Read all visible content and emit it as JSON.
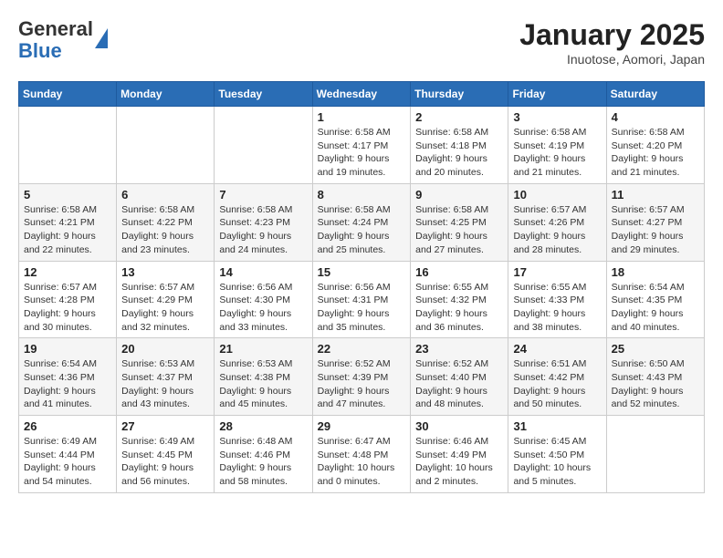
{
  "header": {
    "logo_general": "General",
    "logo_blue": "Blue",
    "month_title": "January 2025",
    "location": "Inuotose, Aomori, Japan"
  },
  "weekdays": [
    "Sunday",
    "Monday",
    "Tuesday",
    "Wednesday",
    "Thursday",
    "Friday",
    "Saturday"
  ],
  "weeks": [
    [
      {
        "day": "",
        "info": ""
      },
      {
        "day": "",
        "info": ""
      },
      {
        "day": "",
        "info": ""
      },
      {
        "day": "1",
        "info": "Sunrise: 6:58 AM\nSunset: 4:17 PM\nDaylight: 9 hours\nand 19 minutes."
      },
      {
        "day": "2",
        "info": "Sunrise: 6:58 AM\nSunset: 4:18 PM\nDaylight: 9 hours\nand 20 minutes."
      },
      {
        "day": "3",
        "info": "Sunrise: 6:58 AM\nSunset: 4:19 PM\nDaylight: 9 hours\nand 21 minutes."
      },
      {
        "day": "4",
        "info": "Sunrise: 6:58 AM\nSunset: 4:20 PM\nDaylight: 9 hours\nand 21 minutes."
      }
    ],
    [
      {
        "day": "5",
        "info": "Sunrise: 6:58 AM\nSunset: 4:21 PM\nDaylight: 9 hours\nand 22 minutes."
      },
      {
        "day": "6",
        "info": "Sunrise: 6:58 AM\nSunset: 4:22 PM\nDaylight: 9 hours\nand 23 minutes."
      },
      {
        "day": "7",
        "info": "Sunrise: 6:58 AM\nSunset: 4:23 PM\nDaylight: 9 hours\nand 24 minutes."
      },
      {
        "day": "8",
        "info": "Sunrise: 6:58 AM\nSunset: 4:24 PM\nDaylight: 9 hours\nand 25 minutes."
      },
      {
        "day": "9",
        "info": "Sunrise: 6:58 AM\nSunset: 4:25 PM\nDaylight: 9 hours\nand 27 minutes."
      },
      {
        "day": "10",
        "info": "Sunrise: 6:57 AM\nSunset: 4:26 PM\nDaylight: 9 hours\nand 28 minutes."
      },
      {
        "day": "11",
        "info": "Sunrise: 6:57 AM\nSunset: 4:27 PM\nDaylight: 9 hours\nand 29 minutes."
      }
    ],
    [
      {
        "day": "12",
        "info": "Sunrise: 6:57 AM\nSunset: 4:28 PM\nDaylight: 9 hours\nand 30 minutes."
      },
      {
        "day": "13",
        "info": "Sunrise: 6:57 AM\nSunset: 4:29 PM\nDaylight: 9 hours\nand 32 minutes."
      },
      {
        "day": "14",
        "info": "Sunrise: 6:56 AM\nSunset: 4:30 PM\nDaylight: 9 hours\nand 33 minutes."
      },
      {
        "day": "15",
        "info": "Sunrise: 6:56 AM\nSunset: 4:31 PM\nDaylight: 9 hours\nand 35 minutes."
      },
      {
        "day": "16",
        "info": "Sunrise: 6:55 AM\nSunset: 4:32 PM\nDaylight: 9 hours\nand 36 minutes."
      },
      {
        "day": "17",
        "info": "Sunrise: 6:55 AM\nSunset: 4:33 PM\nDaylight: 9 hours\nand 38 minutes."
      },
      {
        "day": "18",
        "info": "Sunrise: 6:54 AM\nSunset: 4:35 PM\nDaylight: 9 hours\nand 40 minutes."
      }
    ],
    [
      {
        "day": "19",
        "info": "Sunrise: 6:54 AM\nSunset: 4:36 PM\nDaylight: 9 hours\nand 41 minutes."
      },
      {
        "day": "20",
        "info": "Sunrise: 6:53 AM\nSunset: 4:37 PM\nDaylight: 9 hours\nand 43 minutes."
      },
      {
        "day": "21",
        "info": "Sunrise: 6:53 AM\nSunset: 4:38 PM\nDaylight: 9 hours\nand 45 minutes."
      },
      {
        "day": "22",
        "info": "Sunrise: 6:52 AM\nSunset: 4:39 PM\nDaylight: 9 hours\nand 47 minutes."
      },
      {
        "day": "23",
        "info": "Sunrise: 6:52 AM\nSunset: 4:40 PM\nDaylight: 9 hours\nand 48 minutes."
      },
      {
        "day": "24",
        "info": "Sunrise: 6:51 AM\nSunset: 4:42 PM\nDaylight: 9 hours\nand 50 minutes."
      },
      {
        "day": "25",
        "info": "Sunrise: 6:50 AM\nSunset: 4:43 PM\nDaylight: 9 hours\nand 52 minutes."
      }
    ],
    [
      {
        "day": "26",
        "info": "Sunrise: 6:49 AM\nSunset: 4:44 PM\nDaylight: 9 hours\nand 54 minutes."
      },
      {
        "day": "27",
        "info": "Sunrise: 6:49 AM\nSunset: 4:45 PM\nDaylight: 9 hours\nand 56 minutes."
      },
      {
        "day": "28",
        "info": "Sunrise: 6:48 AM\nSunset: 4:46 PM\nDaylight: 9 hours\nand 58 minutes."
      },
      {
        "day": "29",
        "info": "Sunrise: 6:47 AM\nSunset: 4:48 PM\nDaylight: 10 hours\nand 0 minutes."
      },
      {
        "day": "30",
        "info": "Sunrise: 6:46 AM\nSunset: 4:49 PM\nDaylight: 10 hours\nand 2 minutes."
      },
      {
        "day": "31",
        "info": "Sunrise: 6:45 AM\nSunset: 4:50 PM\nDaylight: 10 hours\nand 5 minutes."
      },
      {
        "day": "",
        "info": ""
      }
    ]
  ]
}
